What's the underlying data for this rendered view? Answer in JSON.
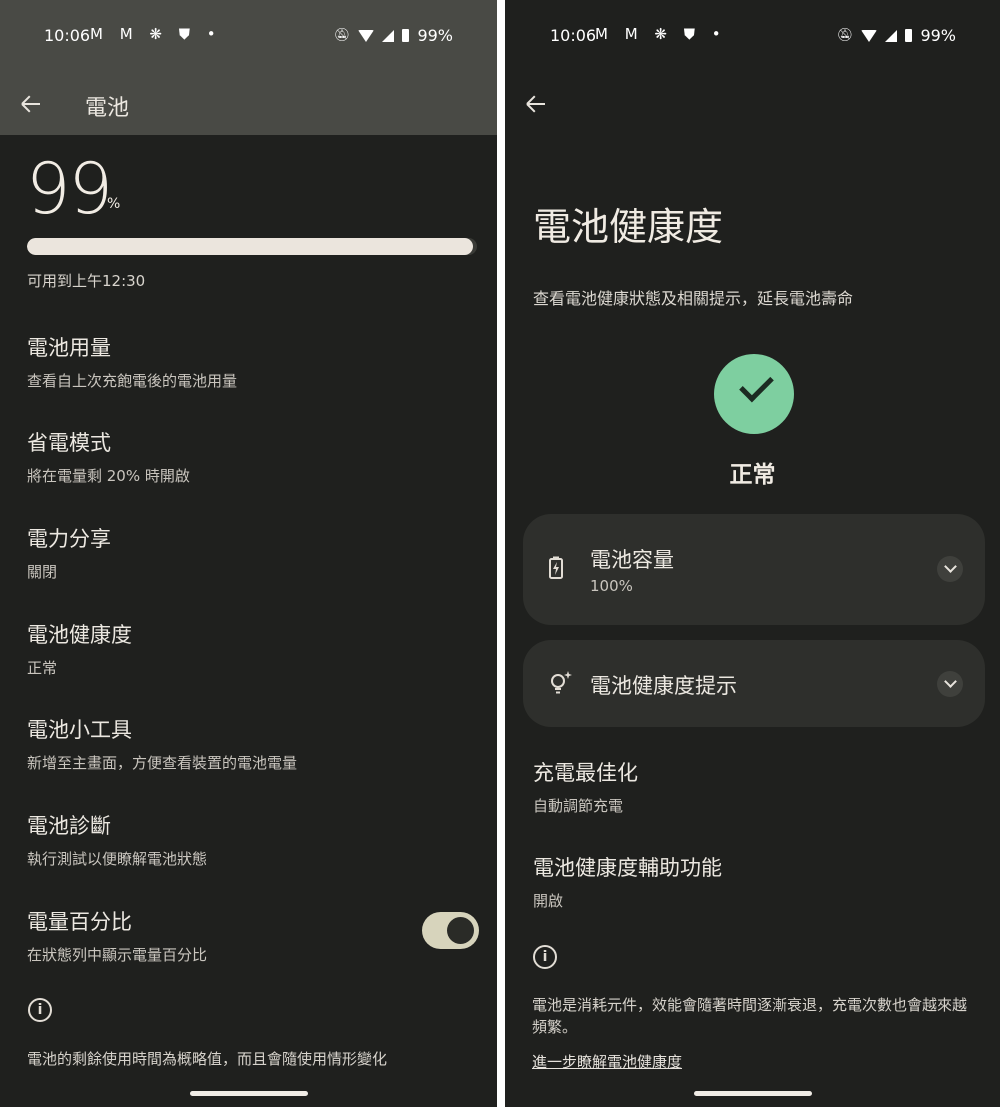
{
  "status_bar": {
    "time": "10:06",
    "notif_icons": "M M ❋ ⛊ •",
    "battery_text": "99%"
  },
  "left": {
    "header": {
      "title": "電池"
    },
    "battery": {
      "level_number": "99",
      "level_unit": "%",
      "level_fraction": 0.99,
      "available_text": "可用到上午12:30"
    },
    "items": [
      {
        "title": "電池用量",
        "subtitle": "查看自上次充飽電後的電池用量"
      },
      {
        "title": "省電模式",
        "subtitle": "將在電量剩 20% 時開啟"
      },
      {
        "title": "電力分享",
        "subtitle": "關閉"
      },
      {
        "title": "電池健康度",
        "subtitle": "正常"
      },
      {
        "title": "電池小工具",
        "subtitle": "新增至主畫面，方便查看裝置的電池電量"
      },
      {
        "title": "電池診斷",
        "subtitle": "執行測試以便瞭解電池狀態"
      },
      {
        "title": "電量百分比",
        "subtitle": "在狀態列中顯示電量百分比",
        "toggle_on": true
      }
    ],
    "footer_text": "電池的剩餘使用時間為概略值，而且會隨使用情形變化"
  },
  "right": {
    "title": "電池健康度",
    "subtitle": "查看電池健康狀態及相關提示，延長電池壽命",
    "status_label": "正常",
    "status_color": "#7ecfa0",
    "cards": [
      {
        "icon": "battery-charging-icon",
        "title": "電池容量",
        "subtitle": "100%"
      },
      {
        "icon": "lightbulb-sparkle-icon",
        "title": "電池健康度提示"
      }
    ],
    "items": [
      {
        "title": "充電最佳化",
        "subtitle": "自動調節充電"
      },
      {
        "title": "電池健康度輔助功能",
        "subtitle": "開啟"
      }
    ],
    "footer_text": "電池是消耗元件，效能會隨著時間逐漸衰退，充電次數也會越來越頻繁。",
    "learn_more_link": "進一步瞭解電池健康度"
  }
}
